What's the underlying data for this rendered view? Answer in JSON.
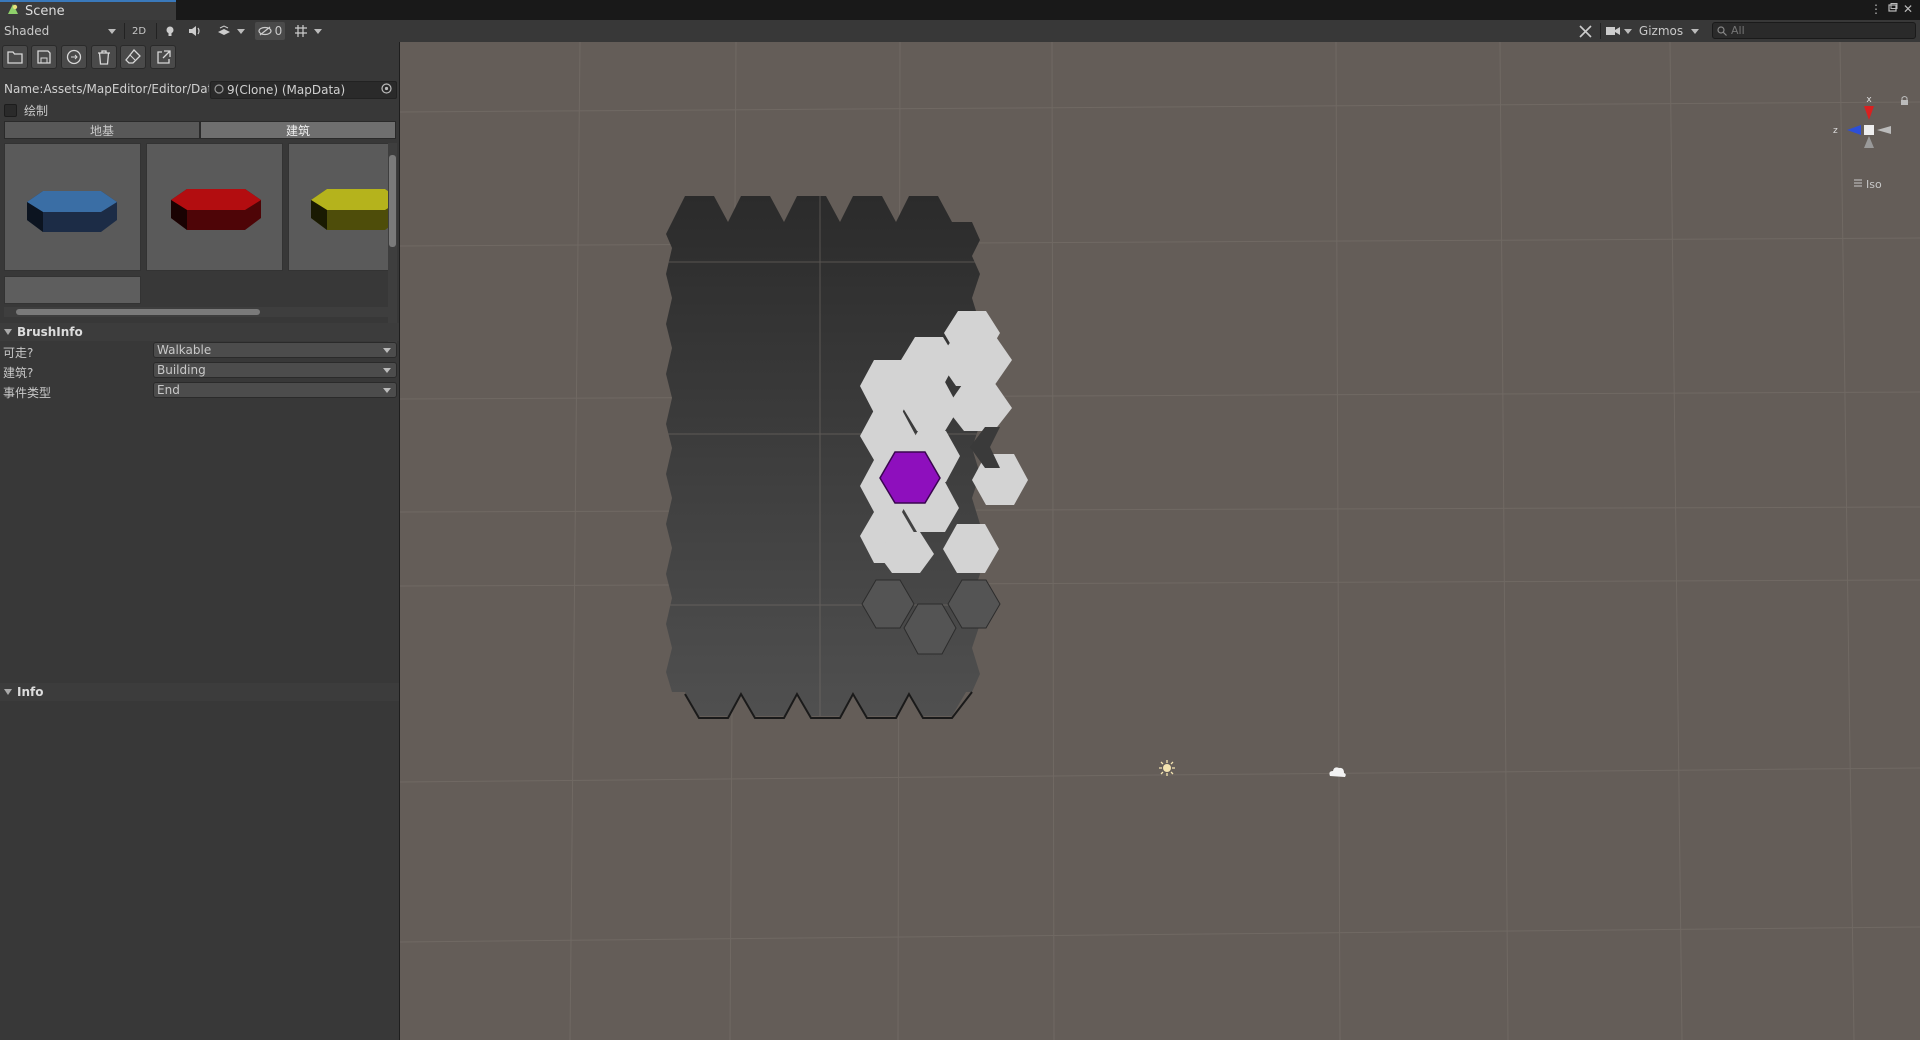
{
  "window": {
    "tab_title": "Scene",
    "controls": [
      "more-icon",
      "maximize-icon",
      "close-icon"
    ]
  },
  "toolbar": {
    "shading_mode": "Shaded",
    "mode_2d_label": "2D",
    "hidden_count": "0",
    "gizmos_label": "Gizmos",
    "search_placeholder": "All"
  },
  "panel": {
    "tools": [
      "open-folder-icon",
      "save-icon",
      "replace-icon",
      "trash-icon",
      "eraser-icon",
      "export-icon"
    ],
    "name_label": "Name:Assets/MapEditor/Editor/Data/",
    "map_object": "9(Clone) (MapData)",
    "draw_label": "绘制",
    "tabs": [
      "地基",
      "建筑"
    ],
    "active_tab_index": 1,
    "palette": [
      {
        "color": "#3a6ea5",
        "shade": "#1c2c46"
      },
      {
        "color": "#b30d10",
        "shade": "#4e0507"
      },
      {
        "color": "#b5b31c",
        "shade": "#4e4d0a"
      }
    ],
    "brushinfo": {
      "header": "BrushInfo",
      "rows": [
        {
          "label": "可走?",
          "value": "Walkable"
        },
        {
          "label": "建筑?",
          "value": "Building"
        },
        {
          "label": "事件类型",
          "value": "End"
        }
      ]
    },
    "info": {
      "header": "Info"
    }
  },
  "scene": {
    "background": "#645d58",
    "grid_color": "#7a736d",
    "map_dark_top": "#2a2a2a",
    "map_dark_bottom": "#505050",
    "highlight_color": "#d3d3d3",
    "selected_color": "#8e0fbd",
    "gizmo": {
      "x_label": "x",
      "z_label": "z",
      "projection": "Iso"
    },
    "icons": [
      "light-icon",
      "cloud-icon"
    ]
  }
}
